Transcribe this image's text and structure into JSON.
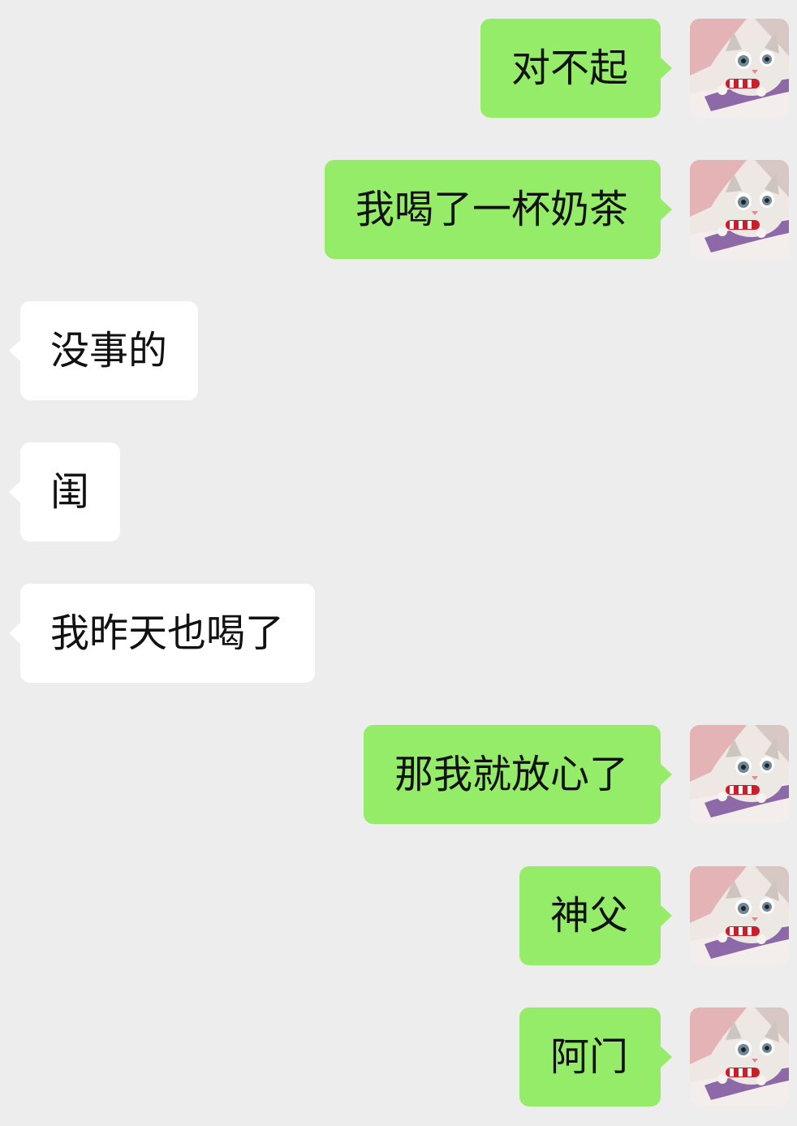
{
  "conversation": {
    "messages": [
      {
        "side": "outgoing",
        "text": "对不起"
      },
      {
        "side": "outgoing",
        "text": "我喝了一杯奶茶"
      },
      {
        "side": "incoming",
        "text": "没事的"
      },
      {
        "side": "incoming",
        "text": "闺"
      },
      {
        "side": "incoming",
        "text": "我昨天也喝了"
      },
      {
        "side": "outgoing",
        "text": "那我就放心了"
      },
      {
        "side": "outgoing",
        "text": "神父"
      },
      {
        "side": "outgoing",
        "text": "阿门"
      }
    ]
  },
  "avatar": {
    "icon": "cat-avatar-icon"
  },
  "colors": {
    "background": "#ededed",
    "outgoing_bubble": "#95ec69",
    "incoming_bubble": "#ffffff",
    "text": "#111111"
  }
}
